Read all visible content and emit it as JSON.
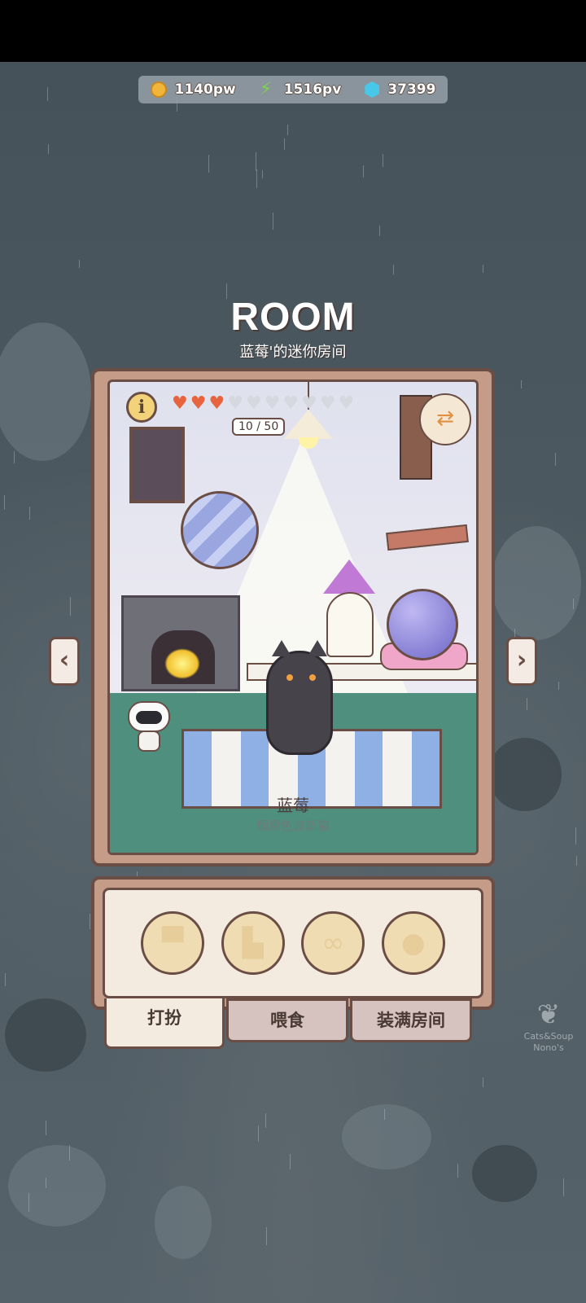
{
  "currency": {
    "coins": "1140pw",
    "energy": "1516pv",
    "gems": "37399"
  },
  "title": "ROOM",
  "subtitle": "蓝莓'的迷你房间",
  "room": {
    "affection_count": "10 / 50",
    "affection_value": 3,
    "affection_max": 10,
    "cat_name": "蓝莓",
    "cat_breed": "烟熏色波斯猫"
  },
  "tabs": [
    "打扮",
    "喂食",
    "装满房间"
  ],
  "active_tab": 0,
  "slots": [
    "hat-slot-icon",
    "shirt-slot-icon",
    "glasses-slot-icon",
    "face-slot-icon"
  ],
  "watermark": "Cats&Soup Nono's",
  "colors": {
    "frame": "#c59c88",
    "outline": "#6a4e46",
    "heart_full": "#e8643e",
    "floor": "#4e8f7e"
  }
}
